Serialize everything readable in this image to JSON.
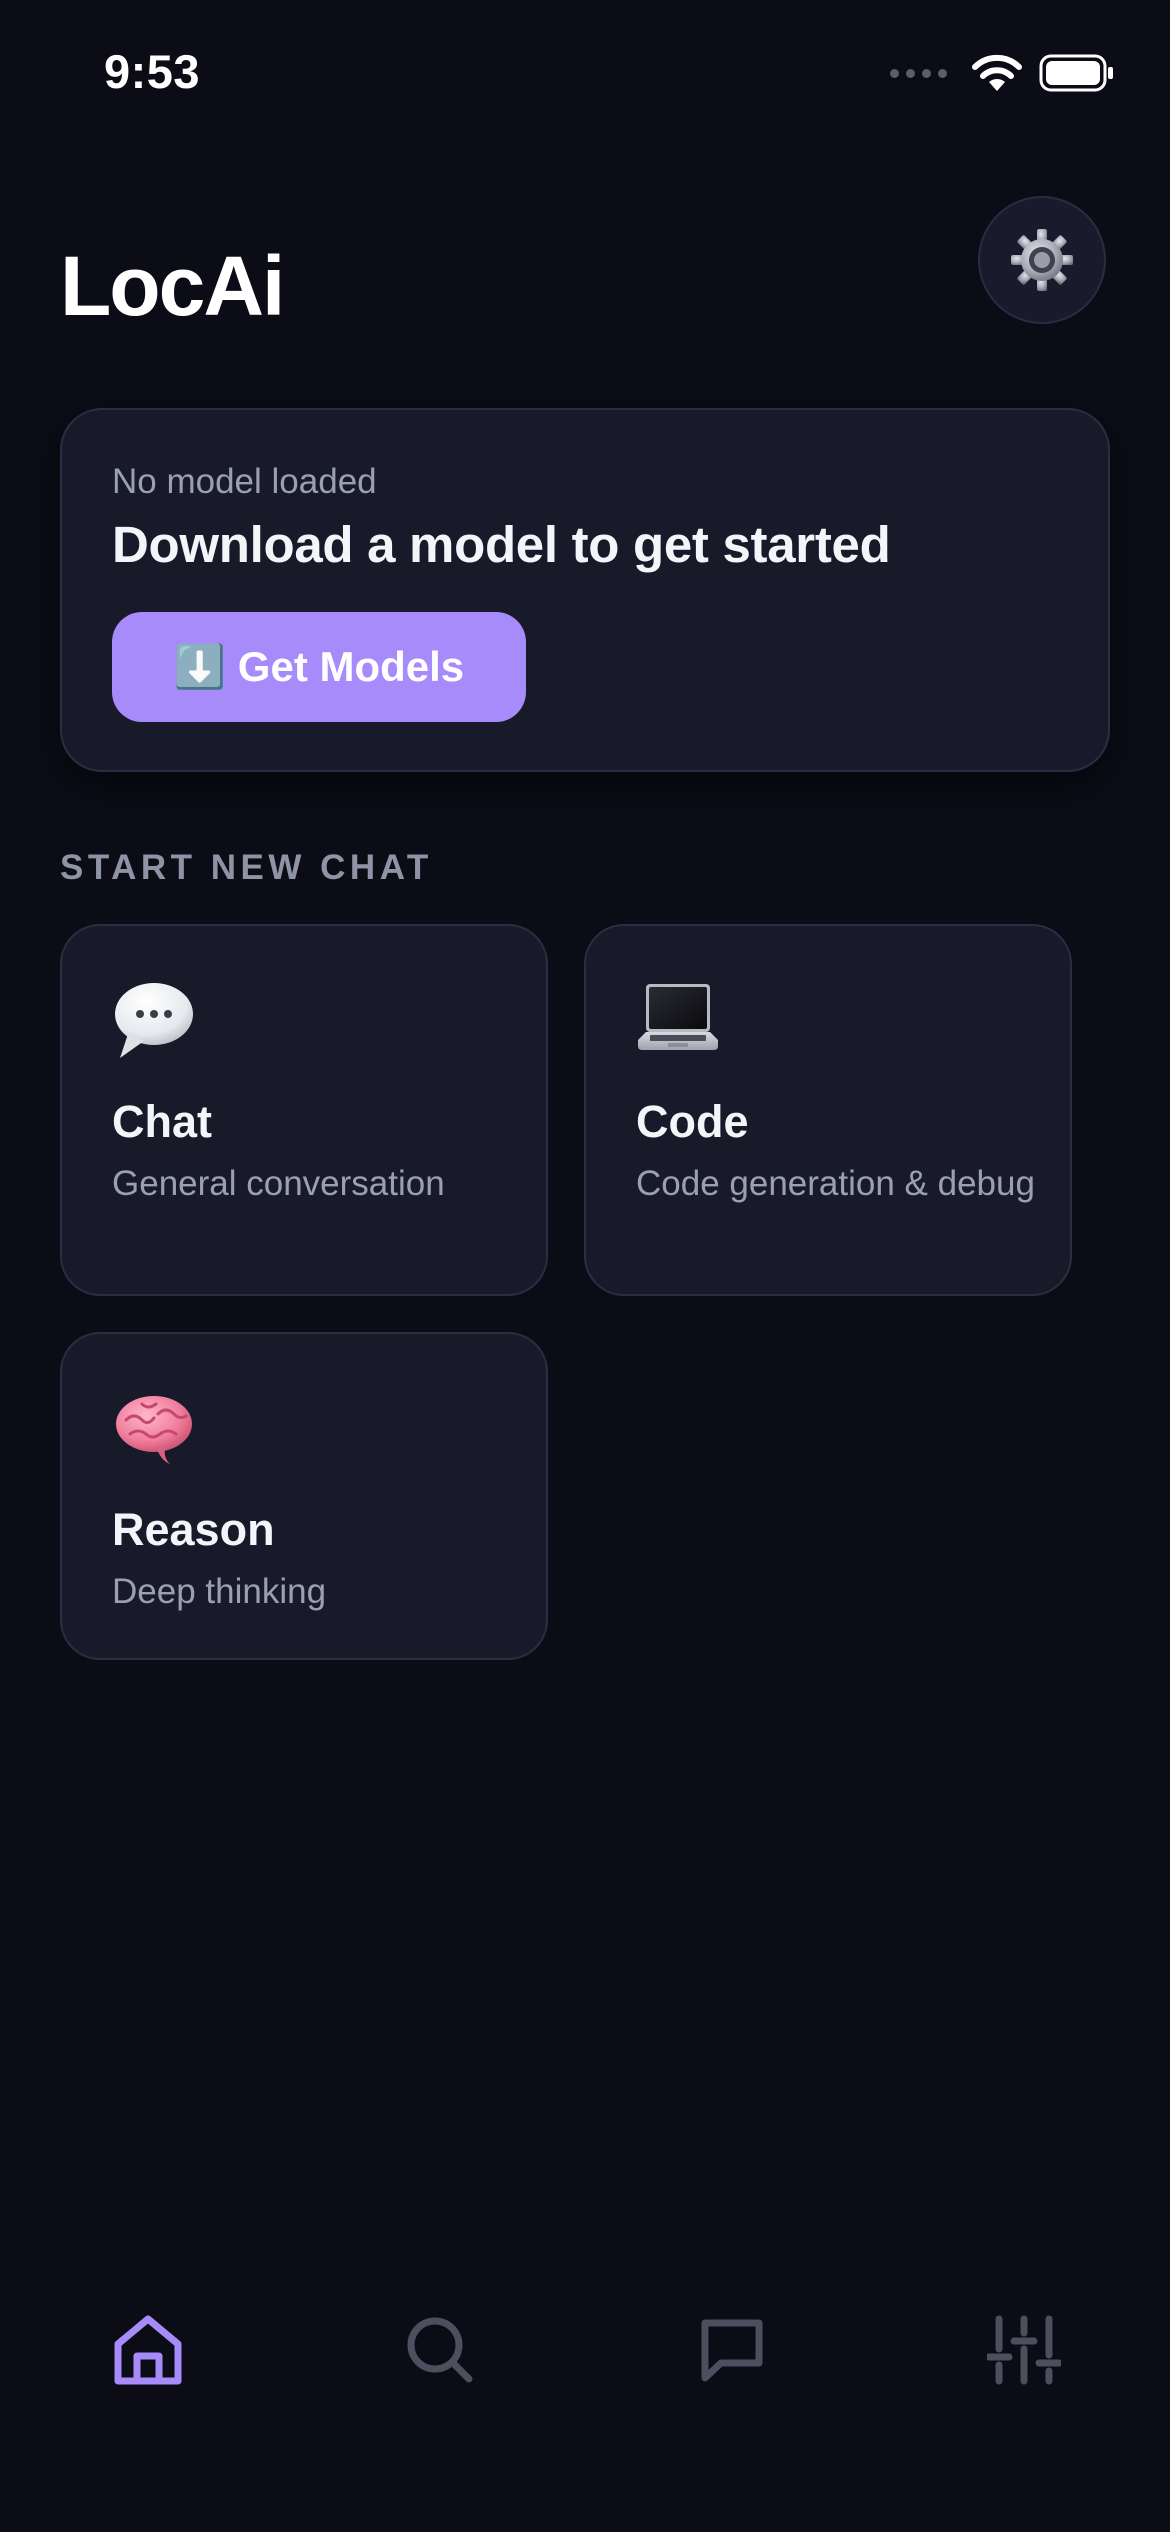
{
  "status_bar": {
    "time": "9:53"
  },
  "header": {
    "title": "LocAi",
    "settings_icon": "gear-icon"
  },
  "model_card": {
    "status": "No model loaded",
    "headline": "Download a model to get started",
    "button_label": "⬇️ Get Models",
    "button_color": "#a78bfa"
  },
  "section": {
    "label": "START NEW CHAT"
  },
  "modes": [
    {
      "title": "Chat",
      "description": "General conversation",
      "icon": "speech-balloon-icon"
    },
    {
      "title": "Code",
      "description": "Code generation & debug",
      "icon": "laptop-icon"
    },
    {
      "title": "Reason",
      "description": "Deep thinking",
      "icon": "brain-icon"
    }
  ],
  "tab_bar": {
    "active": "home",
    "active_color": "#a78bfa",
    "inactive_color": "#4b4f5e",
    "tabs": [
      "home-icon",
      "search-icon",
      "chat-bubble-icon",
      "sliders-icon"
    ]
  },
  "colors": {
    "background": "#0b0c16",
    "card": "#181a2a",
    "card_border": "#2b2d42",
    "muted_text": "#9aa0b3"
  }
}
